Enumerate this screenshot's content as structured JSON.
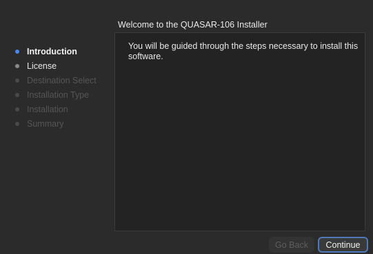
{
  "header": {
    "title": "Welcome to the QUASAR-106 Installer"
  },
  "sidebar": {
    "steps": [
      {
        "label": "Introduction",
        "state": "current",
        "dot_color": "#4a86f0"
      },
      {
        "label": "License",
        "state": "visited",
        "dot_color": "#8a8a8a"
      },
      {
        "label": "Destination Select",
        "state": "future",
        "dot_color": "#4a4a4a"
      },
      {
        "label": "Installation Type",
        "state": "future",
        "dot_color": "#4a4a4a"
      },
      {
        "label": "Installation",
        "state": "future",
        "dot_color": "#4a4a4a"
      },
      {
        "label": "Summary",
        "state": "future",
        "dot_color": "#4a4a4a"
      }
    ]
  },
  "content": {
    "text": "You will be guided through the steps necessary to install this software."
  },
  "buttons": {
    "back_label": "Go Back",
    "back_enabled": false,
    "continue_label": "Continue"
  },
  "colors": {
    "accent": "#4a86f0",
    "focus_ring": "#4f79b8",
    "background": "#2b2b2b",
    "content_background": "#232323"
  }
}
